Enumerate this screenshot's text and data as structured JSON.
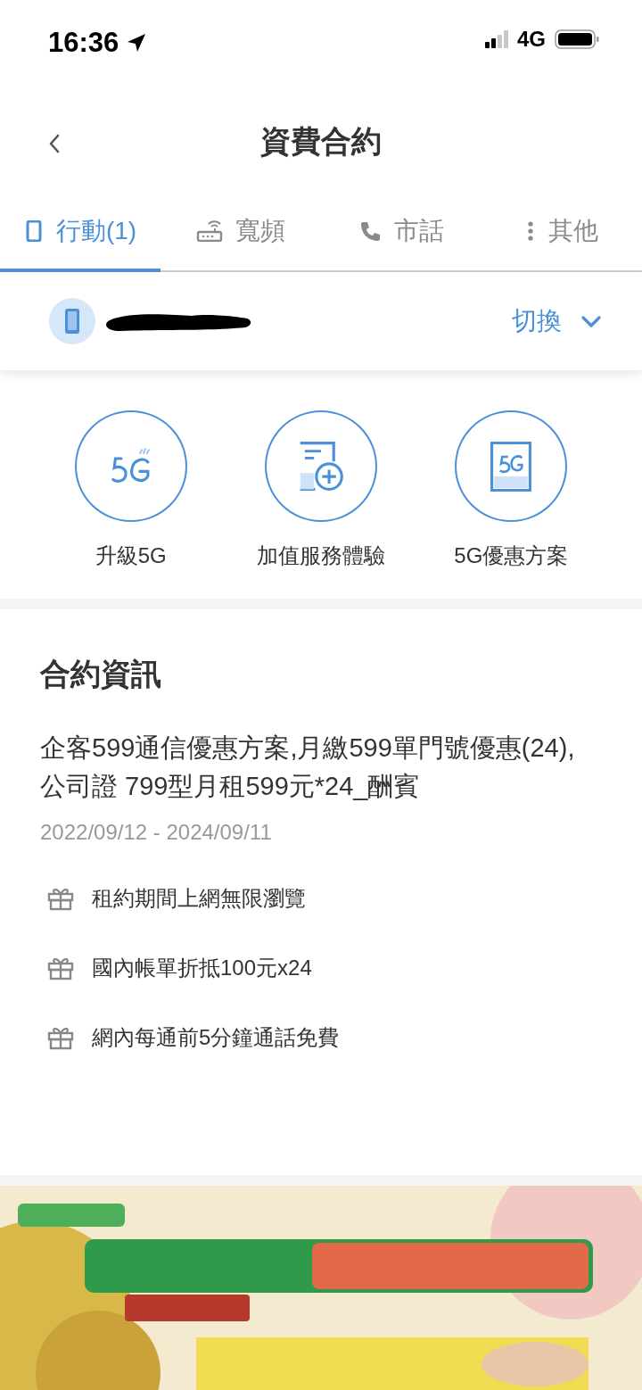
{
  "status_bar": {
    "time": "16:36",
    "network": "4G"
  },
  "header": {
    "title": "資費合約"
  },
  "tabs": [
    {
      "label": "行動(1)",
      "kind": "mobile",
      "selected": true
    },
    {
      "label": "寬頻",
      "kind": "router",
      "selected": false
    },
    {
      "label": "市話",
      "kind": "phone",
      "selected": false
    },
    {
      "label": "其他",
      "kind": "more",
      "selected": false
    }
  ],
  "account": {
    "switch_label": "切換"
  },
  "shortcuts": [
    {
      "label": "升級5G",
      "kind": "upgrade"
    },
    {
      "label": "加值服務體驗",
      "kind": "addon"
    },
    {
      "label": "5G優惠方案",
      "kind": "plan"
    }
  ],
  "contract": {
    "heading": "合約資訊",
    "plan": "企客599通信優惠方案,月繳599單門號優惠(24),公司證 799型月租599元*24_酬賓",
    "period": "2022/09/12 - 2024/09/11",
    "benefits": [
      "租約期間上網無限瀏覽",
      "國內帳單折抵100元x24",
      "網內每通前5分鐘通話免費"
    ]
  }
}
